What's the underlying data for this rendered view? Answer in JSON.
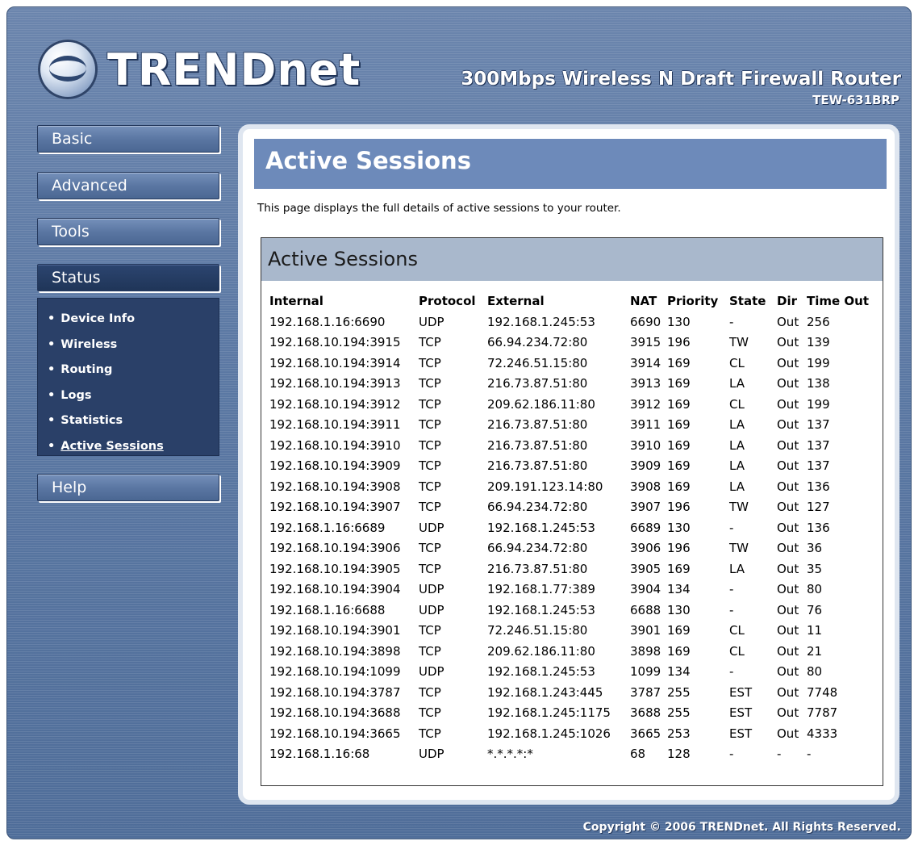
{
  "header": {
    "brand": "TRENDnet",
    "product_title": "300Mbps Wireless N Draft Firewall Router",
    "model": "TEW-631BRP"
  },
  "sidebar": {
    "basic": "Basic",
    "advanced": "Advanced",
    "tools": "Tools",
    "status": "Status",
    "status_items": [
      "Device Info",
      "Wireless",
      "Routing",
      "Logs",
      "Statistics",
      "Active Sessions"
    ],
    "help": "Help"
  },
  "page": {
    "title": "Active Sessions",
    "description": "This page displays the full details of active sessions to your router.",
    "box_title": "Active Sessions"
  },
  "table": {
    "columns": [
      "Internal",
      "Protocol",
      "External",
      "NAT",
      "Priority",
      "State",
      "Dir",
      "Time Out"
    ],
    "rows": [
      [
        "192.168.1.16:6690",
        "UDP",
        "192.168.1.245:53",
        "6690",
        "130",
        "-",
        "Out",
        "256"
      ],
      [
        "192.168.10.194:3915",
        "TCP",
        "66.94.234.72:80",
        "3915",
        "196",
        "TW",
        "Out",
        "139"
      ],
      [
        "192.168.10.194:3914",
        "TCP",
        "72.246.51.15:80",
        "3914",
        "169",
        "CL",
        "Out",
        "199"
      ],
      [
        "192.168.10.194:3913",
        "TCP",
        "216.73.87.51:80",
        "3913",
        "169",
        "LA",
        "Out",
        "138"
      ],
      [
        "192.168.10.194:3912",
        "TCP",
        "209.62.186.11:80",
        "3912",
        "169",
        "CL",
        "Out",
        "199"
      ],
      [
        "192.168.10.194:3911",
        "TCP",
        "216.73.87.51:80",
        "3911",
        "169",
        "LA",
        "Out",
        "137"
      ],
      [
        "192.168.10.194:3910",
        "TCP",
        "216.73.87.51:80",
        "3910",
        "169",
        "LA",
        "Out",
        "137"
      ],
      [
        "192.168.10.194:3909",
        "TCP",
        "216.73.87.51:80",
        "3909",
        "169",
        "LA",
        "Out",
        "137"
      ],
      [
        "192.168.10.194:3908",
        "TCP",
        "209.191.123.14:80",
        "3908",
        "169",
        "LA",
        "Out",
        "136"
      ],
      [
        "192.168.10.194:3907",
        "TCP",
        "66.94.234.72:80",
        "3907",
        "196",
        "TW",
        "Out",
        "127"
      ],
      [
        "192.168.1.16:6689",
        "UDP",
        "192.168.1.245:53",
        "6689",
        "130",
        "-",
        "Out",
        "136"
      ],
      [
        "192.168.10.194:3906",
        "TCP",
        "66.94.234.72:80",
        "3906",
        "196",
        "TW",
        "Out",
        "36"
      ],
      [
        "192.168.10.194:3905",
        "TCP",
        "216.73.87.51:80",
        "3905",
        "169",
        "LA",
        "Out",
        "35"
      ],
      [
        "192.168.10.194:3904",
        "UDP",
        "192.168.1.77:389",
        "3904",
        "134",
        "-",
        "Out",
        "80"
      ],
      [
        "192.168.1.16:6688",
        "UDP",
        "192.168.1.245:53",
        "6688",
        "130",
        "-",
        "Out",
        "76"
      ],
      [
        "192.168.10.194:3901",
        "TCP",
        "72.246.51.15:80",
        "3901",
        "169",
        "CL",
        "Out",
        "11"
      ],
      [
        "192.168.10.194:3898",
        "TCP",
        "209.62.186.11:80",
        "3898",
        "169",
        "CL",
        "Out",
        "21"
      ],
      [
        "192.168.10.194:1099",
        "UDP",
        "192.168.1.245:53",
        "1099",
        "134",
        "-",
        "Out",
        "80"
      ],
      [
        "192.168.10.194:3787",
        "TCP",
        "192.168.1.243:445",
        "3787",
        "255",
        "EST",
        "Out",
        "7748"
      ],
      [
        "192.168.10.194:3688",
        "TCP",
        "192.168.1.245:1175",
        "3688",
        "255",
        "EST",
        "Out",
        "7787"
      ],
      [
        "192.168.10.194:3665",
        "TCP",
        "192.168.1.245:1026",
        "3665",
        "253",
        "EST",
        "Out",
        "4333"
      ],
      [
        "192.168.1.16:68",
        "UDP",
        "*.*.*.*:*",
        "68",
        "128",
        "-",
        "-",
        "-"
      ]
    ]
  },
  "footer": {
    "copyright": "Copyright © 2006 TRENDnet. All Rights Reserved."
  },
  "colors": {
    "frame_bg": "#5c79a4",
    "page_header_bg": "#6d8aba",
    "box_header_bg": "#a9b8cc",
    "active_nav_bg": "#2a4068"
  }
}
